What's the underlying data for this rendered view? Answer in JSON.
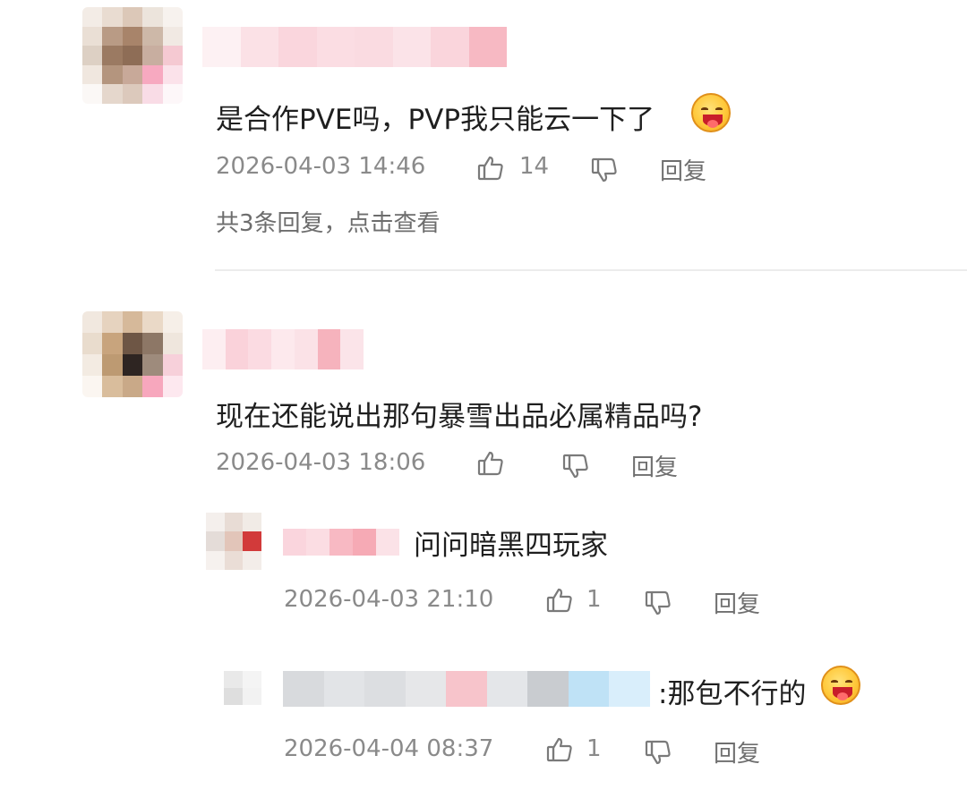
{
  "comments": [
    {
      "text": "是合作PVE吗，PVP我只能云一下了",
      "time": "2026-04-03 14:46",
      "likes": "14",
      "reply_label": "回复",
      "replies_link": "共3条回复，点击查看",
      "emoji": "grinning-face-with-tongue-icon"
    },
    {
      "text": "现在还能说出那句暴雪出品必属精品吗?",
      "time": "2026-04-03 18:06",
      "reply_label": "回复",
      "replies": [
        {
          "text": "问问暗黑四玩家",
          "time": "2026-04-03 21:10",
          "likes": "1",
          "reply_label": "回复"
        },
        {
          "text": ":那包不行的",
          "time": "2026-04-04 08:37",
          "likes": "1",
          "reply_label": "回复",
          "emoji": "grinning-face-with-tongue-icon"
        }
      ]
    }
  ],
  "colors": {
    "text": "#1f1f1f",
    "meta": "#8a8a8a",
    "divider": "#ececec",
    "pink_name": "#f6b5bf",
    "blue_name": "#bfe0f5"
  }
}
